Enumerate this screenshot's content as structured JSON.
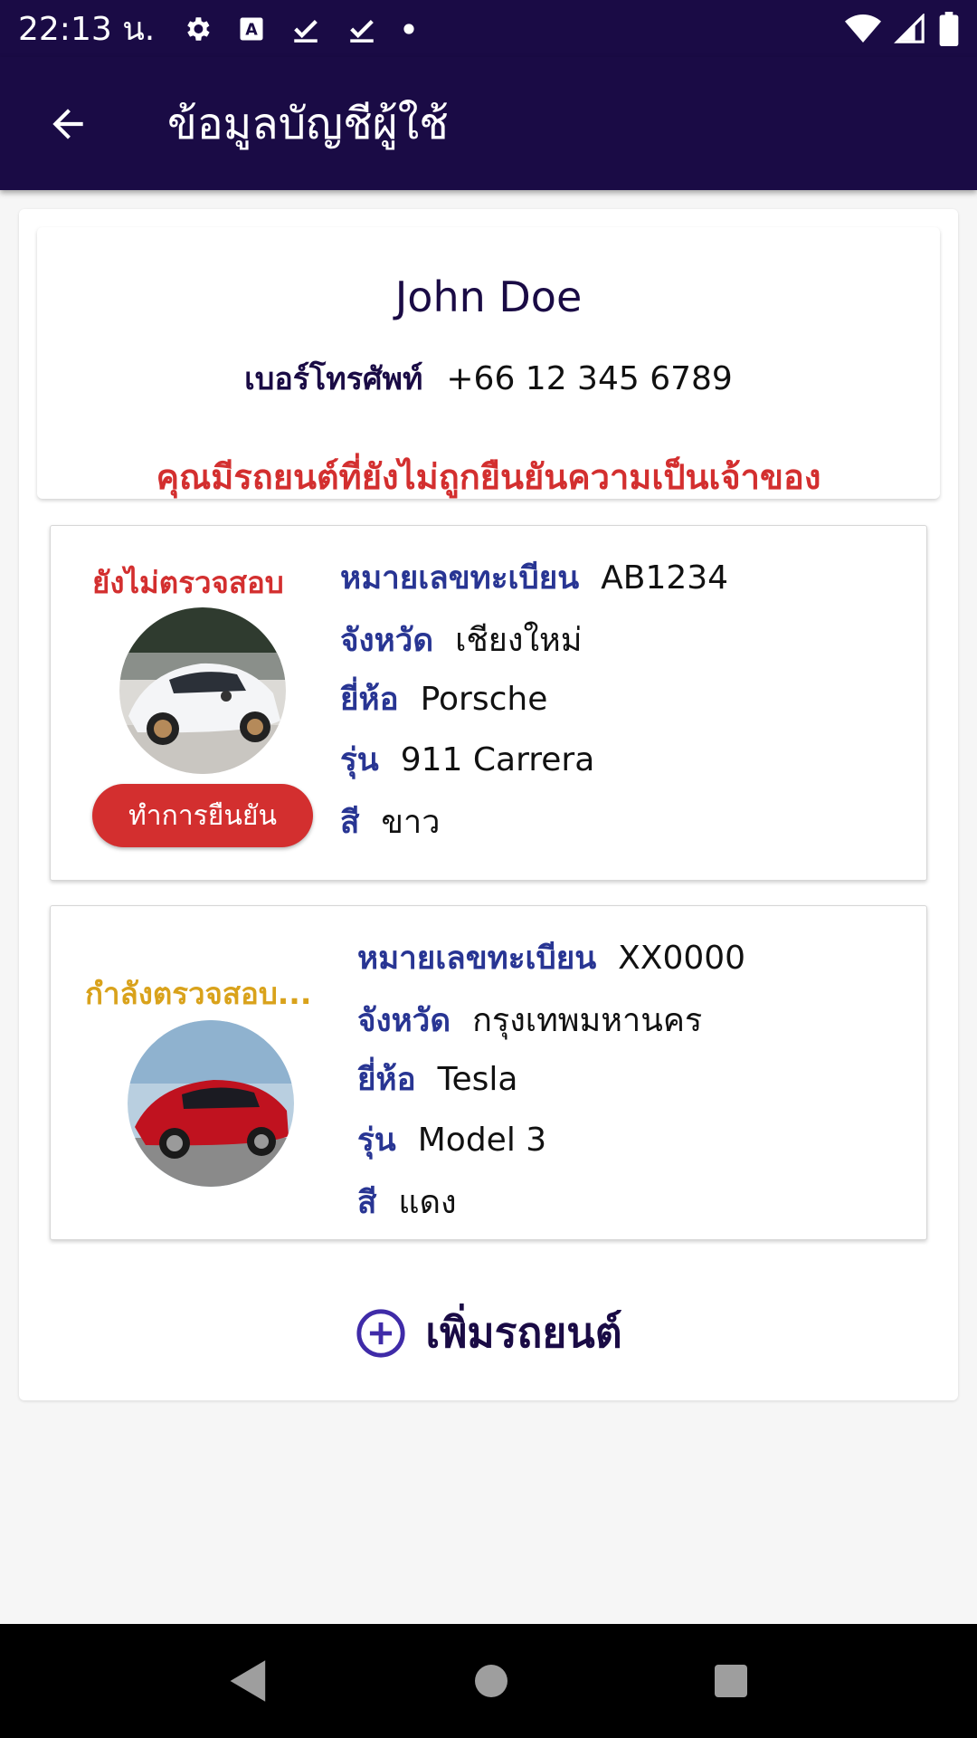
{
  "status_bar": {
    "time": "22:13 น.",
    "left_icons": [
      "gear-icon",
      "text-a-icon",
      "check-icon",
      "check-icon",
      "dot-icon"
    ],
    "right_icons": [
      "wifi-icon",
      "signal-icon",
      "battery-icon"
    ]
  },
  "app_bar": {
    "title": "ข้อมูลบัญชีผู้ใช้",
    "back_icon": "arrow-back-icon"
  },
  "profile": {
    "name": "John Doe",
    "phone_label": "เบอร์โทรศัพท์",
    "phone": "+66 12 345 6789",
    "warning": "คุณมีรถยนต์ที่ยังไม่ถูกยืนยันความเป็นเจ้าของ"
  },
  "cars": [
    {
      "status": "ยังไม่ตรวจสอบ",
      "status_color": "#d32f2f",
      "verify_label": "ทำการยืนยัน",
      "fields": [
        {
          "label": "หมายเลขทะเบียน",
          "value": "AB1234"
        },
        {
          "label": "จังหวัด",
          "value": "เชียงใหม่"
        },
        {
          "label": "ยี่ห้อ",
          "value": "Porsche"
        },
        {
          "label": "รุ่น",
          "value": "911 Carrera"
        },
        {
          "label": "สี",
          "value": "ขาว"
        }
      ]
    },
    {
      "status": "กำลังตรวจสอบ...",
      "status_color": "#d9a21b",
      "fields": [
        {
          "label": "หมายเลขทะเบียน",
          "value": "XX0000"
        },
        {
          "label": "จังหวัด",
          "value": "กรุงเทพมหานคร"
        },
        {
          "label": "ยี่ห้อ",
          "value": "Tesla"
        },
        {
          "label": "รุ่น",
          "value": "Model 3"
        },
        {
          "label": "สี",
          "value": "แดง"
        }
      ]
    }
  ],
  "add_car": {
    "label": "เพิ่มรถยนต์",
    "icon": "add-circle-icon"
  },
  "colors": {
    "primary": "#1a0b45",
    "label_blue": "#283593",
    "danger": "#d32f2f",
    "pending": "#d9a21b"
  }
}
